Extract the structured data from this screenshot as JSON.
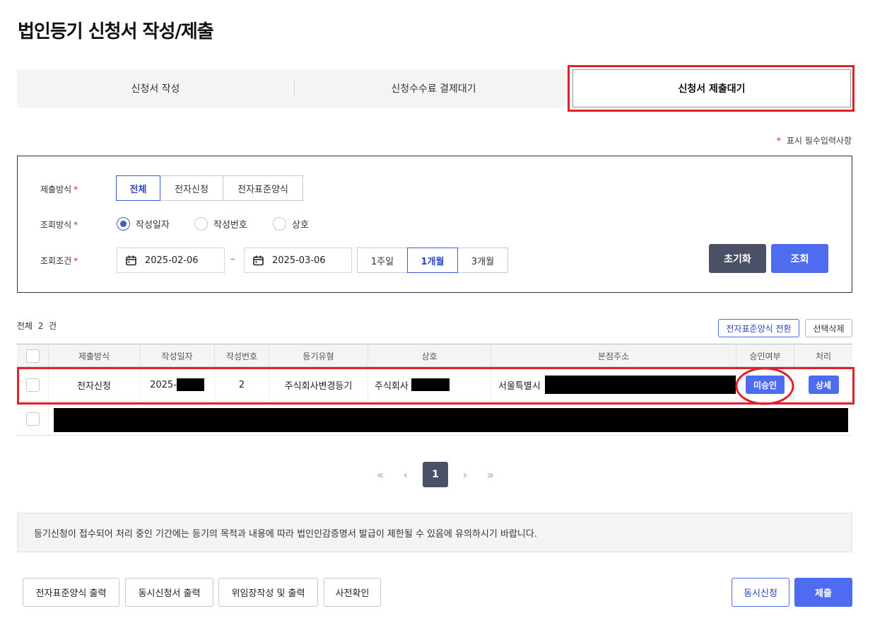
{
  "page": {
    "title": "법인등기 신청서 작성/제출"
  },
  "tabs": [
    {
      "label": "신청서 작성"
    },
    {
      "label": "신청수수료 결제대기"
    },
    {
      "label": "신청서 제출대기",
      "active": true
    }
  ],
  "required_note": {
    "star": "*",
    "text": "표시 필수입력사항"
  },
  "search": {
    "submit_method": {
      "label": "제출방식",
      "star": "*",
      "options": [
        "전체",
        "전자신청",
        "전자표준양식"
      ],
      "selected": "전체"
    },
    "query_method": {
      "label": "조회방식",
      "star": "*",
      "options": [
        "작성일자",
        "작성번호",
        "상호"
      ],
      "selected": "작성일자"
    },
    "query_condition": {
      "label": "조회조건",
      "star": "*",
      "date_from": "2025-02-06",
      "date_sep": "–",
      "date_to": "2025-03-06",
      "periods": [
        "1주일",
        "1개월",
        "3개월"
      ],
      "selected_period": "1개월"
    },
    "reset_label": "초기화",
    "search_label": "조회"
  },
  "list": {
    "total_label": "전체",
    "total_count": "2",
    "total_unit": "건",
    "convert_label": "전자표준양식 전환",
    "delete_label": "선택삭제",
    "columns": [
      "제출방식",
      "작성일자",
      "작성번호",
      "등기유형",
      "상호",
      "본점주소",
      "승인여부",
      "처리"
    ],
    "rows": [
      {
        "submit_method": "전자신청",
        "date_prefix": "2025-",
        "number": "2",
        "type": "주식회사변경등기",
        "company_prefix": "주식회사",
        "address_prefix": "서울특별시",
        "approval": "미승인",
        "action": "상세"
      }
    ]
  },
  "pagination": {
    "first": "«",
    "prev": "‹",
    "current": "1",
    "next": "›",
    "last": "»"
  },
  "notice": "등기신청이 접수되어 처리 중인 기간에는 등기의 목적과 내용에 따라 법인인감증명서 발급이 제한될 수 있음에 유의하시기 바랍니다.",
  "footer": {
    "btn_print_standard": "전자표준양식 출력",
    "btn_print_simultaneous": "동시신청서 출력",
    "btn_power_of_attorney": "위임장작성 및 출력",
    "btn_precheck": "사전확인",
    "btn_simultaneous": "동시신청",
    "btn_submit": "제출"
  },
  "colors": {
    "accent": "#4f6cf0",
    "dark": "#4a5066",
    "highlight": "#e0202a"
  }
}
